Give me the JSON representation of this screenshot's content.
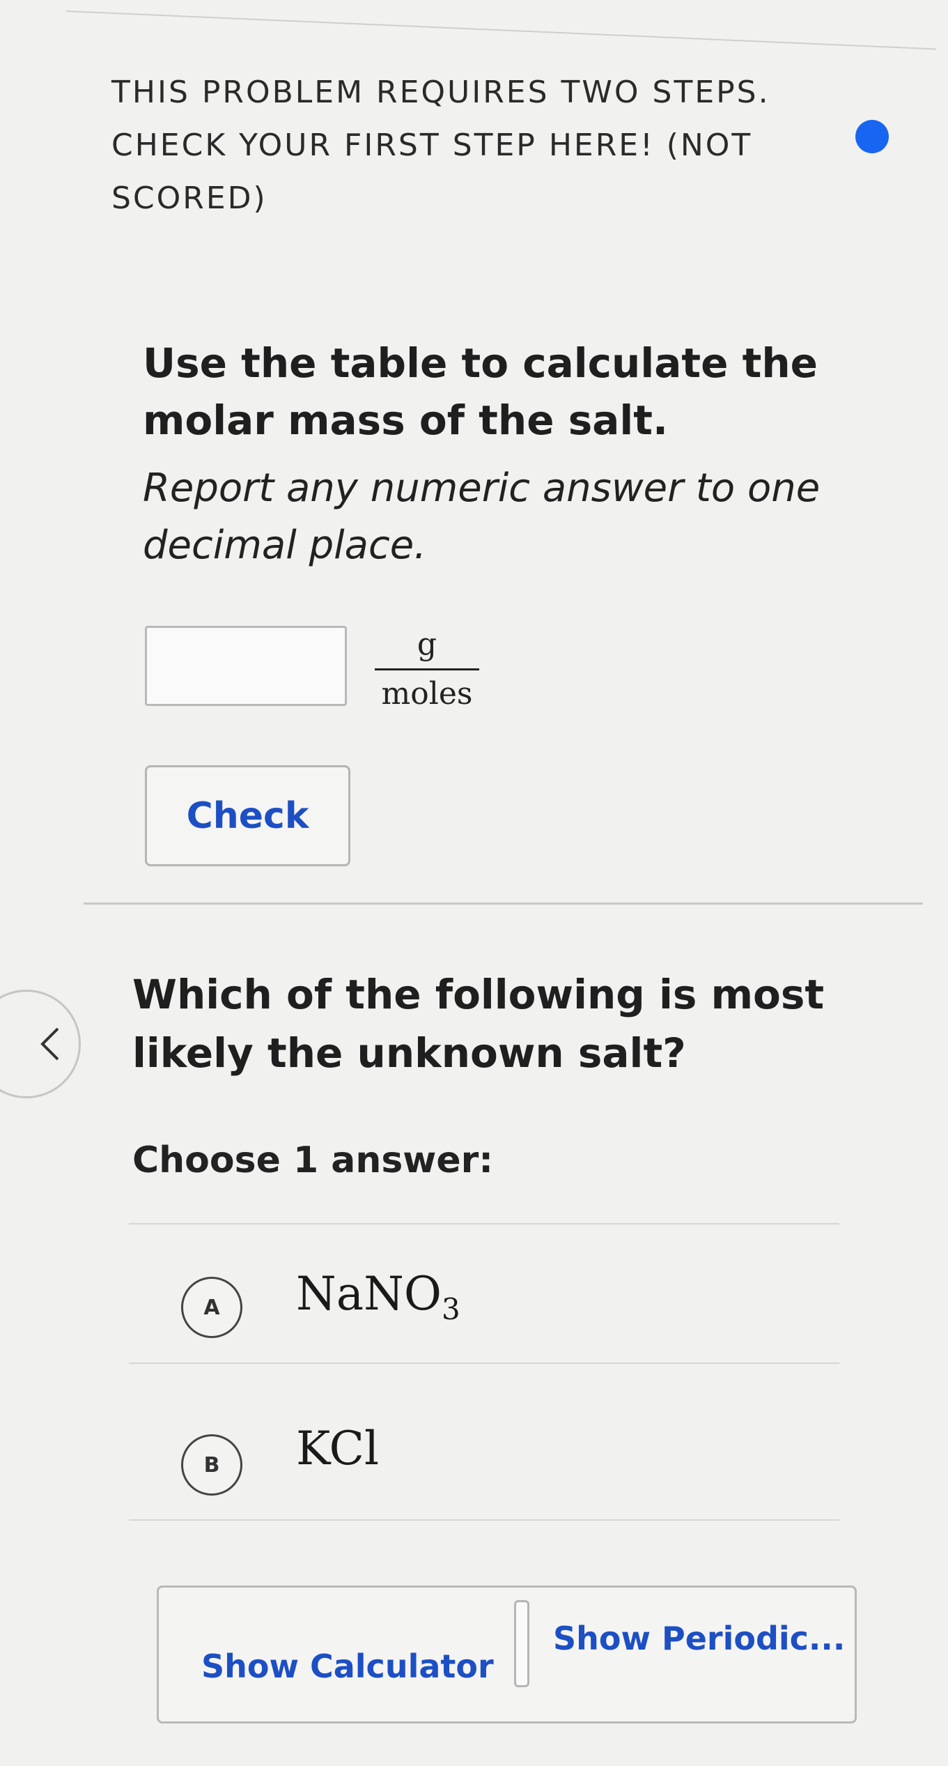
{
  "header": {
    "step_note": "THIS PROBLEM REQUIRES TWO STEPS. CHECK YOUR FIRST STEP HERE! (NOT SCORED)",
    "indicator_color": "#1865f2"
  },
  "step1": {
    "prompt": "Use the table to calculate the molar mass of the salt.",
    "instruction": "Report any numeric answer to one decimal place.",
    "input_value": "",
    "unit_numerator": "g",
    "unit_denominator": "moles",
    "check_label": "Check"
  },
  "step2": {
    "question": "Which of the following is most likely the unknown salt?",
    "choose_label": "Choose 1 answer:",
    "choices": [
      {
        "letter": "A",
        "formula_main": "NaNO",
        "formula_sub": "3"
      },
      {
        "letter": "B",
        "formula_main": "KCl",
        "formula_sub": ""
      }
    ]
  },
  "toolbar": {
    "calculator_label": "Show Calculator",
    "periodic_label": "Show Periodic..."
  },
  "icons": {
    "back": "chevron-left-icon",
    "indicator": "status-dot-icon"
  },
  "colors": {
    "link_blue": "#1d4fc4",
    "background": "#f1f1ef"
  }
}
